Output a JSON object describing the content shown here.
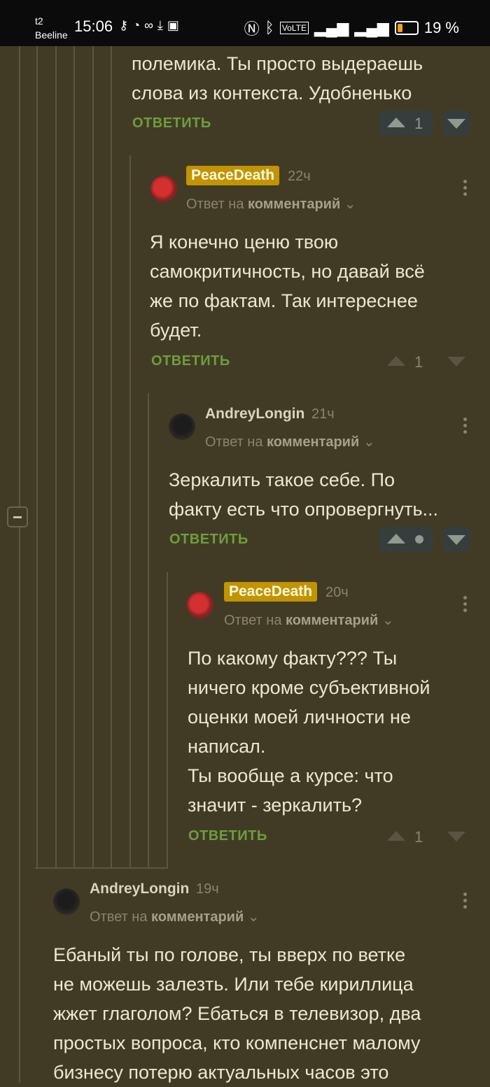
{
  "status_bar": {
    "carrier1": "t2",
    "carrier2": "Beeline",
    "time": "15:06",
    "left_icons": [
      "key-icon",
      "shield-icon",
      "link-icon",
      "download-icon",
      "wb-icon"
    ],
    "right_icons": [
      "nfc-icon",
      "bluetooth-icon",
      "volte-icon",
      "signal-icon",
      "4g-signal-icon"
    ],
    "battery": "19 %"
  },
  "comment0": {
    "text": "полемика. Ты просто выдераешь\nслова из контекста. Удобненько",
    "reply_label": "ОТВЕТИТЬ",
    "score": "1"
  },
  "comment1": {
    "author": "PeaceDeath",
    "time_ago": "22ч",
    "reply_to_prefix": "Ответ на",
    "reply_to_link": "комментарий",
    "text": "Я конечно ценю твою\nсамокритичность, но давай всё\nже по фактам. Так интереснее\nбудет.",
    "reply_label": "ОТВЕТИТЬ",
    "score": "1"
  },
  "comment2": {
    "author": "AndreyLongin",
    "time_ago": "21ч",
    "reply_to_prefix": "Ответ на",
    "reply_to_link": "комментарий",
    "text": "Зеркалить такое себе. По\nфакту есть что опровергнуть...",
    "reply_label": "ОТВЕТИТЬ"
  },
  "comment3": {
    "author": "PeaceDeath",
    "time_ago": "20ч",
    "reply_to_prefix": "Ответ на",
    "reply_to_link": "комментарий",
    "text": "По какому факту??? Ты\nничего кроме субъективной\nоценки моей личности не\nнаписал.\nТы вообще а курсе: что\nзначит - зеркалить?",
    "reply_label": "ОТВЕТИТЬ",
    "score": "1"
  },
  "comment4": {
    "author": "AndreyLongin",
    "time_ago": "19ч",
    "reply_to_prefix": "Ответ на",
    "reply_to_link": "комментарий",
    "text": "Ебаный ты по голове, ты вверх по ветке\nне можешь залезть. Или тебе кириллица\nжжет глаголом? Ебаться в телевизор, два\nпростых вопроса, кто компенснет малому\nбизнесу потерю актуальных часов это"
  },
  "colors": {
    "background": "#413b26",
    "reply": "#6d9e3d",
    "badge": "#c29400"
  }
}
